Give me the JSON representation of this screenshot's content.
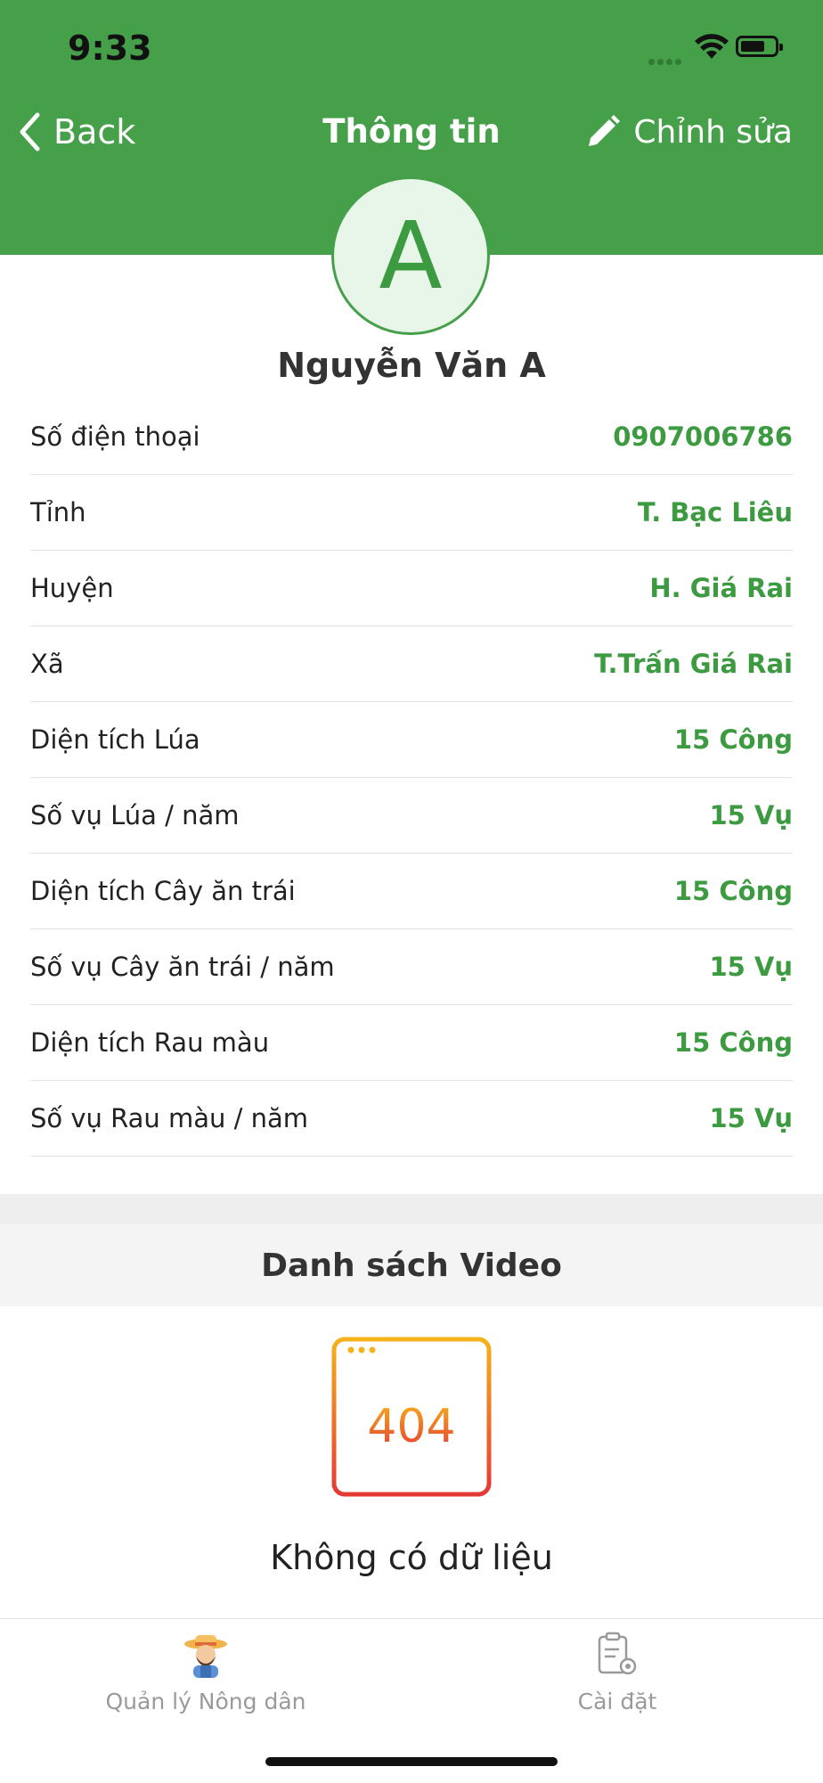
{
  "status_bar": {
    "time": "9:33"
  },
  "nav": {
    "back_label": "Back",
    "title": "Thông tin",
    "edit_label": "Chỉnh sửa"
  },
  "profile": {
    "avatar_letter": "A",
    "name": "Nguyễn Văn A"
  },
  "info_rows": [
    {
      "label": "Số điện thoại",
      "value": "0907006786"
    },
    {
      "label": "Tỉnh",
      "value": "T. Bạc Liêu"
    },
    {
      "label": "Huyện",
      "value": "H. Giá Rai"
    },
    {
      "label": "Xã",
      "value": "T.Trấn Giá Rai"
    },
    {
      "label": "Diện tích Lúa",
      "value": "15 Công"
    },
    {
      "label": "Số vụ Lúa / năm",
      "value": "15 Vụ"
    },
    {
      "label": "Diện tích Cây ăn trái",
      "value": "15 Công"
    },
    {
      "label": "Số vụ Cây ăn trái / năm",
      "value": "15 Vụ"
    },
    {
      "label": "Diện tích Rau màu",
      "value": "15 Công"
    },
    {
      "label": "Số vụ Rau màu / năm",
      "value": "15 Vụ"
    }
  ],
  "video_section": {
    "title": "Danh sách Video",
    "empty_code": "404",
    "empty_text": "Không có dữ liệu"
  },
  "tabbar": {
    "tabs": [
      {
        "label": "Quản lý Nông dân",
        "icon": "farmer-icon"
      },
      {
        "label": "Cài đặt",
        "icon": "settings-clipboard-icon"
      }
    ]
  },
  "colors": {
    "primary_green": "#45a049",
    "value_green": "#3c9a40",
    "empty_icon_gradient": [
      "#f5b21b",
      "#e53935"
    ]
  }
}
